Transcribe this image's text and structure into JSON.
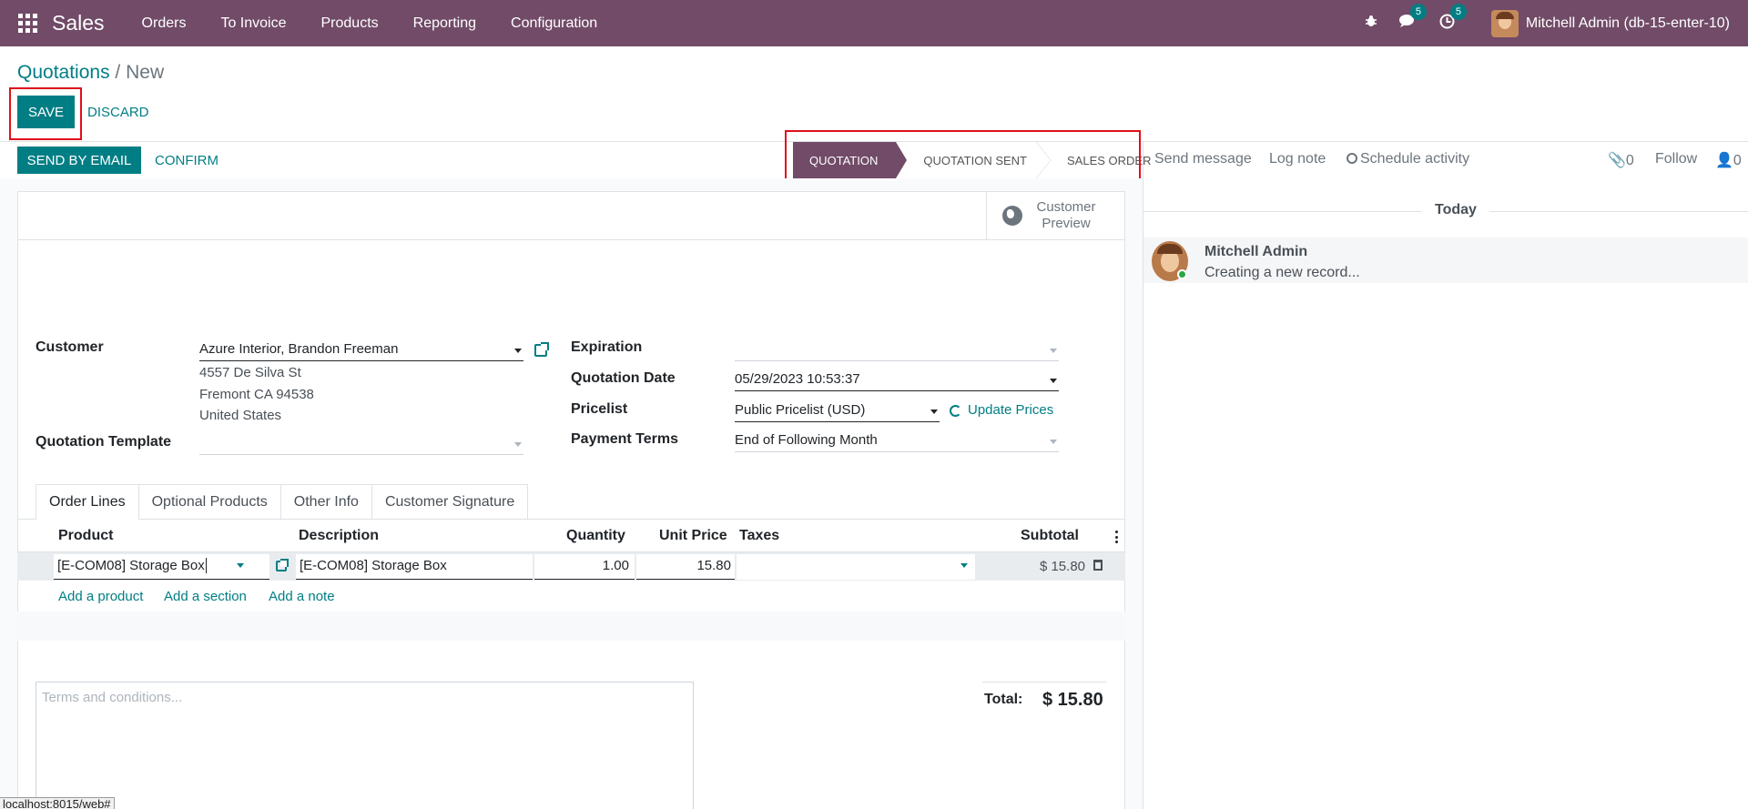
{
  "navbar": {
    "brand": "Sales",
    "menu": [
      "Orders",
      "To Invoice",
      "Products",
      "Reporting",
      "Configuration"
    ],
    "messages_count": "5",
    "activities_count": "5",
    "user": "Mitchell Admin (db-15-enter-10)"
  },
  "breadcrumb": {
    "parent": "Quotations",
    "separator": "/",
    "current": "New"
  },
  "buttons": {
    "save": "SAVE",
    "discard": "DISCARD",
    "send_by_email": "SEND BY EMAIL",
    "confirm": "CONFIRM"
  },
  "statusbar": {
    "steps": [
      "QUOTATION",
      "QUOTATION SENT",
      "SALES ORDER"
    ],
    "active": "QUOTATION"
  },
  "smart_button": {
    "customer_preview": "Customer Preview"
  },
  "form": {
    "customer_label": "Customer",
    "customer_value": "Azure Interior, Brandon Freeman",
    "address": [
      "4557 De Silva St",
      "Fremont CA 94538",
      "United States"
    ],
    "quotation_template_label": "Quotation Template",
    "quotation_template_value": "",
    "expiration_label": "Expiration",
    "expiration_value": "",
    "quotation_date_label": "Quotation Date",
    "quotation_date_value": "05/29/2023 10:53:37",
    "pricelist_label": "Pricelist",
    "pricelist_value": "Public Pricelist (USD)",
    "update_prices": "Update Prices",
    "payment_terms_label": "Payment Terms",
    "payment_terms_value": "End of Following Month"
  },
  "tabs": [
    "Order Lines",
    "Optional Products",
    "Other Info",
    "Customer Signature"
  ],
  "order_lines": {
    "columns": [
      "Product",
      "Description",
      "Quantity",
      "Unit Price",
      "Taxes",
      "Subtotal"
    ],
    "rows": [
      {
        "product": "[E-COM08] Storage Box",
        "description": "[E-COM08] Storage Box",
        "quantity": "1.00",
        "unit_price": "15.80",
        "taxes": "",
        "subtotal": "$ 15.80"
      }
    ],
    "add_product": "Add a product",
    "add_section": "Add a section",
    "add_note": "Add a note"
  },
  "terms_placeholder": "Terms and conditions...",
  "totals": {
    "label": "Total:",
    "value": "$ 15.80"
  },
  "chatter": {
    "send_message": "Send message",
    "log_note": "Log note",
    "schedule_activity": "Schedule activity",
    "attachments_count": "0",
    "follow": "Follow",
    "followers_count": "0",
    "date_separator": "Today",
    "message_author": "Mitchell Admin",
    "message_body": "Creating a new record..."
  },
  "browser_status_url": "localhost:8015/web#",
  "colors": {
    "brand": "#714b67",
    "primary": "#017e84",
    "highlight": "#e0101a"
  }
}
